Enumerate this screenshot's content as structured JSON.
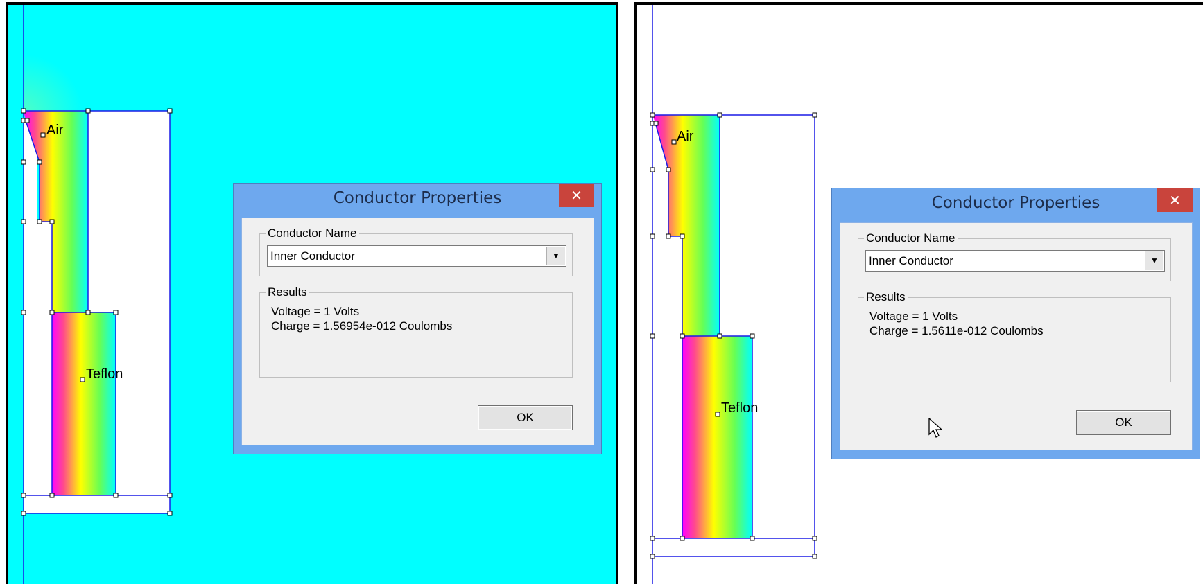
{
  "left_panel": {
    "background": "#00ffff",
    "labels": {
      "air": "Air",
      "teflon": "Teflon"
    },
    "dialog": {
      "title": "Conductor Properties",
      "close_icon": "close-icon",
      "conductor_name_group": "Conductor Name",
      "conductor_name_value": "Inner Conductor",
      "results_group": "Results",
      "voltage_line": "Voltage = 1 Volts",
      "charge_line": "Charge = 1.56954e-012 Coulombs",
      "ok_label": "OK"
    }
  },
  "right_panel": {
    "background": "#ffffff",
    "labels": {
      "air": "Air",
      "teflon": "Teflon"
    },
    "dialog": {
      "title": "Conductor Properties",
      "close_icon": "close-icon",
      "conductor_name_group": "Conductor Name",
      "conductor_name_value": "Inner Conductor",
      "results_group": "Results",
      "voltage_line": "Voltage = 1 Volts",
      "charge_line": "Charge = 1.5611e-012 Coulombs",
      "ok_label": "OK"
    },
    "cursor_icon": "mouse-pointer-icon"
  },
  "colors": {
    "geometry_line": "#1a1ae6",
    "gradient": [
      "#ff00ff",
      "#ff4a8c",
      "#ffff00",
      "#66ff55",
      "#00ffff"
    ],
    "dialog_frame": "#6ea8ee",
    "close_button": "#c9443c"
  }
}
